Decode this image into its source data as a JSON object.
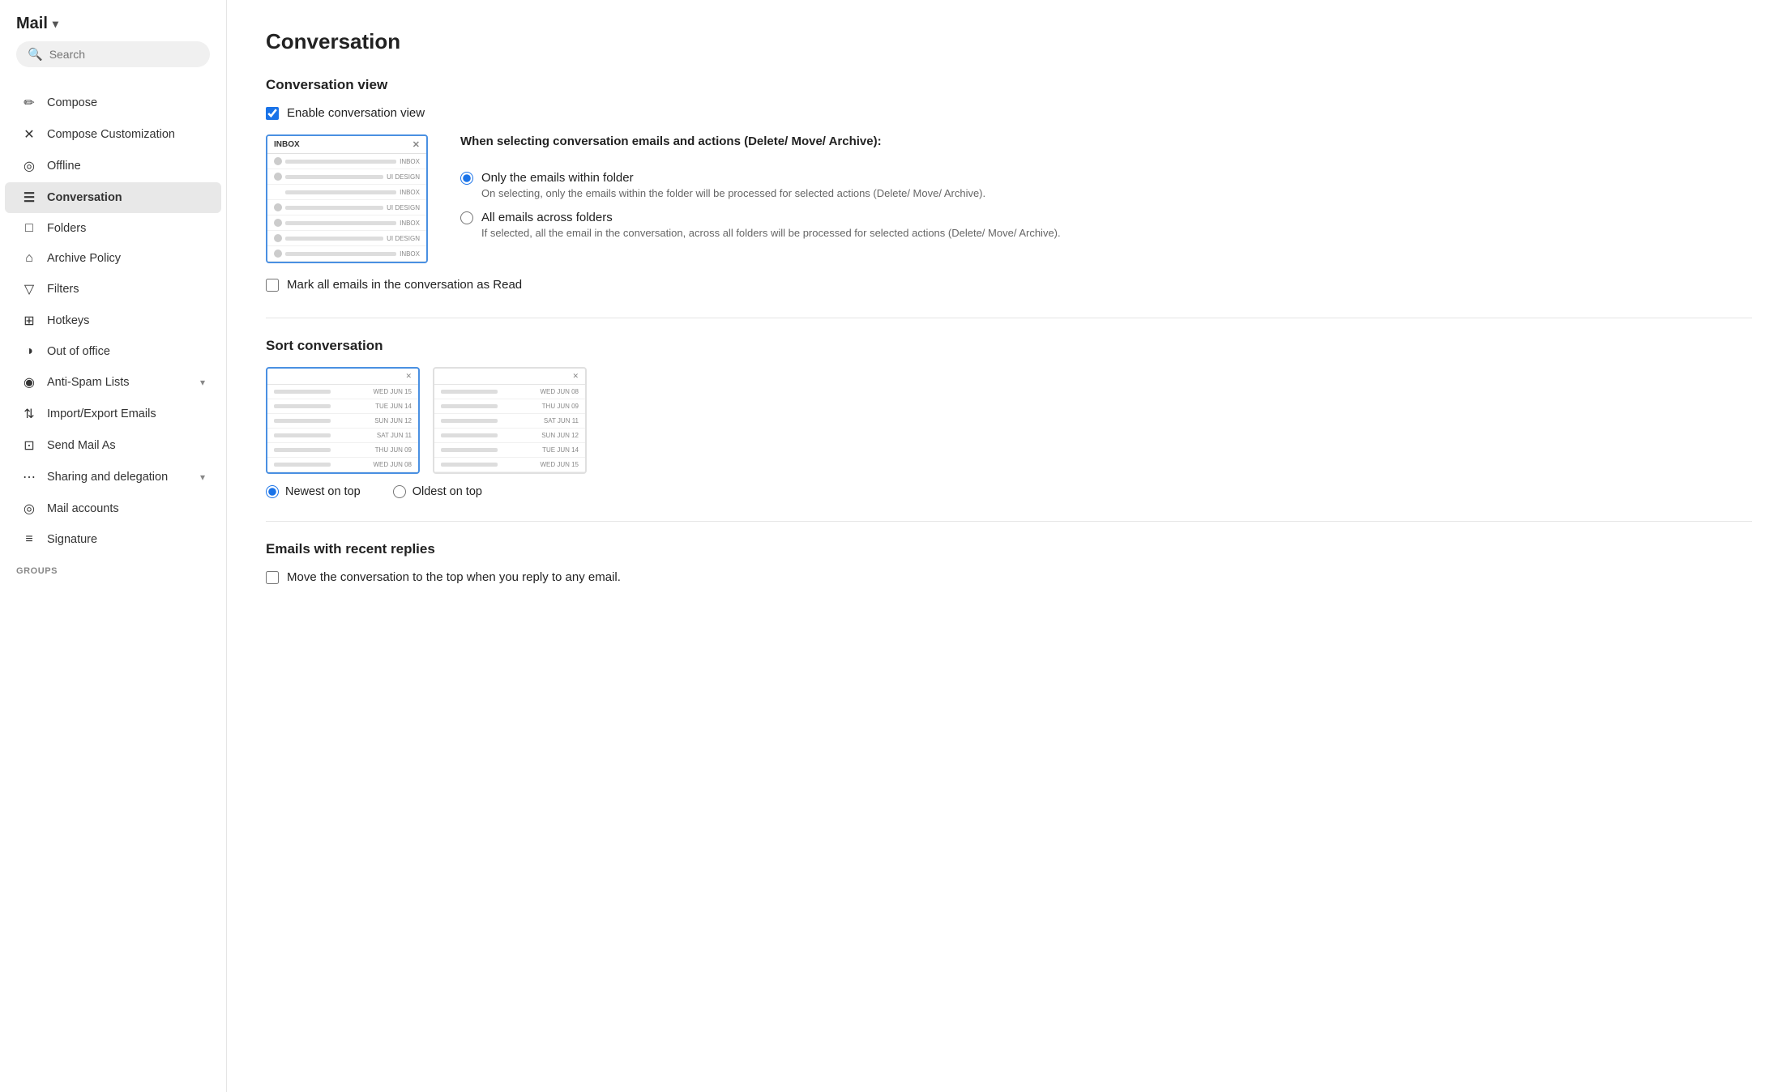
{
  "app": {
    "title": "Mail",
    "chevron": "▾"
  },
  "search": {
    "placeholder": "Search"
  },
  "sidebar": {
    "items": [
      {
        "id": "compose",
        "label": "Compose",
        "icon": "✏",
        "active": false,
        "hasChevron": false
      },
      {
        "id": "compose-customization",
        "label": "Compose Customization",
        "icon": "✕",
        "active": false,
        "hasChevron": false
      },
      {
        "id": "offline",
        "label": "Offline",
        "icon": "◎",
        "active": false,
        "hasChevron": false
      },
      {
        "id": "conversation",
        "label": "Conversation",
        "icon": "☰",
        "active": true,
        "hasChevron": false
      },
      {
        "id": "folders",
        "label": "Folders",
        "icon": "□",
        "active": false,
        "hasChevron": false
      },
      {
        "id": "archive-policy",
        "label": "Archive Policy",
        "icon": "⌂",
        "active": false,
        "hasChevron": false
      },
      {
        "id": "filters",
        "label": "Filters",
        "icon": "▽",
        "active": false,
        "hasChevron": false
      },
      {
        "id": "hotkeys",
        "label": "Hotkeys",
        "icon": "⊞",
        "active": false,
        "hasChevron": false
      },
      {
        "id": "out-of-office",
        "label": "Out of office",
        "icon": "◑",
        "active": false,
        "hasChevron": false
      },
      {
        "id": "anti-spam",
        "label": "Anti-Spam Lists",
        "icon": "◉",
        "active": false,
        "hasChevron": true
      },
      {
        "id": "import-export",
        "label": "Import/Export Emails",
        "icon": "⇅",
        "active": false,
        "hasChevron": false
      },
      {
        "id": "send-mail-as",
        "label": "Send Mail As",
        "icon": "⊡",
        "active": false,
        "hasChevron": false
      },
      {
        "id": "sharing",
        "label": "Sharing and delegation",
        "icon": "⋯",
        "active": false,
        "hasChevron": true
      },
      {
        "id": "mail-accounts",
        "label": "Mail accounts",
        "icon": "◎",
        "active": false,
        "hasChevron": false
      },
      {
        "id": "signature",
        "label": "Signature",
        "icon": "≡",
        "active": false,
        "hasChevron": false
      }
    ],
    "groups_label": "GROUPS"
  },
  "main": {
    "page_title": "Conversation",
    "conversation_view": {
      "section_title": "Conversation view",
      "enable_label": "Enable conversation view",
      "enable_checked": true,
      "when_label": "When selecting conversation emails and actions (Delete/ Move/ Archive):",
      "option1_label": "Only the emails within folder",
      "option1_desc": "On selecting, only the emails within the folder will be processed for selected actions (Delete/ Move/ Archive).",
      "option1_selected": true,
      "option2_label": "All emails across folders",
      "option2_desc": "If selected, all the email in the conversation, across all folders will be processed for selected actions (Delete/ Move/ Archive).",
      "option2_selected": false,
      "mark_read_label": "Mark all emails in the conversation as Read",
      "mark_read_checked": false,
      "preview_header": "INBOX",
      "preview_close": "✕",
      "preview_rows": [
        {
          "label": "INBOX"
        },
        {
          "label": "UI DESIGN"
        },
        {
          "label": "INBOX"
        },
        {
          "label": "UI DESIGN"
        },
        {
          "label": "INBOX"
        },
        {
          "label": "UI DESIGN"
        },
        {
          "label": "INBOX"
        }
      ]
    },
    "sort_conversation": {
      "section_title": "Sort conversation",
      "newest_label": "Newest on top",
      "oldest_label": "Oldest on top",
      "newest_selected": true,
      "oldest_selected": false,
      "newest_rows": [
        {
          "date": "WED JUN 15"
        },
        {
          "date": "TUE JUN 14"
        },
        {
          "date": "SUN JUN 12"
        },
        {
          "date": "SAT JUN 11"
        },
        {
          "date": "THU JUN 09"
        },
        {
          "date": "WED JUN 08"
        }
      ],
      "oldest_rows": [
        {
          "date": "WED JUN 08"
        },
        {
          "date": "THU JUN 09"
        },
        {
          "date": "SAT JUN 11"
        },
        {
          "date": "SUN JUN 12"
        },
        {
          "date": "TUE JUN 14"
        },
        {
          "date": "WED JUN 15"
        }
      ]
    },
    "recent_replies": {
      "section_title": "Emails with recent replies",
      "move_label": "Move the conversation to the top when you reply to any email.",
      "move_checked": false
    }
  }
}
